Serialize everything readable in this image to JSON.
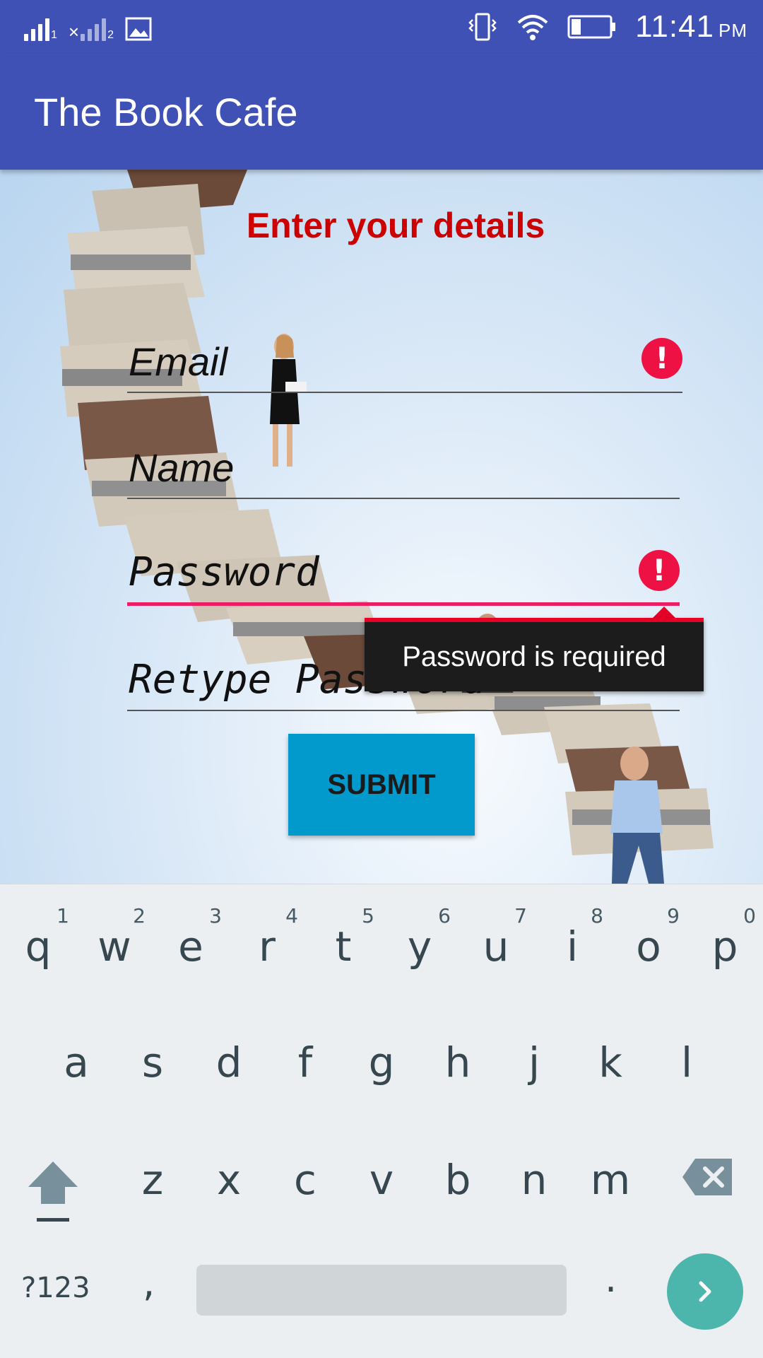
{
  "status_bar": {
    "sim1_label": "1",
    "sim2_label": "2",
    "time": "11:41",
    "ampm": "PM",
    "icons": [
      "signal-icon",
      "signal-no-service-icon",
      "image-notification-icon",
      "vibrate-icon",
      "wifi-icon",
      "battery-icon"
    ]
  },
  "app_bar": {
    "title": "The Book Cafe"
  },
  "form": {
    "heading": "Enter your details",
    "email_label": "Email",
    "name_label": "Name",
    "password_label": "Password",
    "retype_label": "Retype Password",
    "error_mark": "!",
    "tooltip": "Password is required",
    "submit_label": "SUBMIT"
  },
  "keyboard": {
    "row1": [
      {
        "ch": "q",
        "hint": "1"
      },
      {
        "ch": "w",
        "hint": "2"
      },
      {
        "ch": "e",
        "hint": "3"
      },
      {
        "ch": "r",
        "hint": "4"
      },
      {
        "ch": "t",
        "hint": "5"
      },
      {
        "ch": "y",
        "hint": "6"
      },
      {
        "ch": "u",
        "hint": "7"
      },
      {
        "ch": "i",
        "hint": "8"
      },
      {
        "ch": "o",
        "hint": "9"
      },
      {
        "ch": "p",
        "hint": "0"
      }
    ],
    "row2": [
      "a",
      "s",
      "d",
      "f",
      "g",
      "h",
      "j",
      "k",
      "l"
    ],
    "row3": [
      "z",
      "x",
      "c",
      "v",
      "b",
      "n",
      "m"
    ],
    "symbols_label": "?123",
    "comma": ",",
    "period": ".",
    "accent_color": "#4db6ac"
  },
  "colors": {
    "primary": "#3f51b5",
    "heading": "#cc0000",
    "error": "#ee1144",
    "focus_underline": "#e91e63",
    "button": "#0299cc"
  }
}
